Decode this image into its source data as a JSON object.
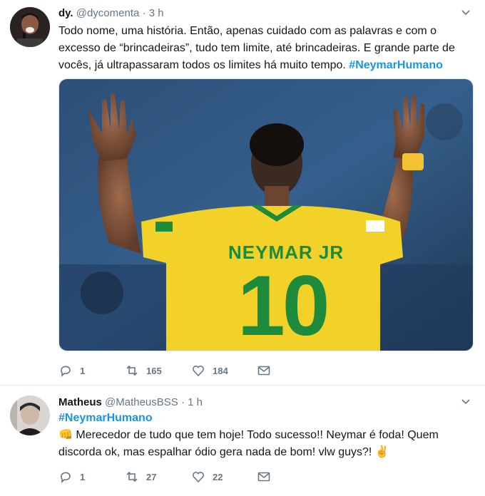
{
  "tweets": [
    {
      "name": "dy.",
      "handle": "@dycomenta",
      "dot": "·",
      "time": "3 h",
      "text_line1": "Todo nome, uma história. Então, apenas cuidado com as palavras e com o",
      "text_line2": "excesso de “brincadeiras”, tudo tem limite, até brincadeiras. E grande parte de",
      "text_line3": "vocês, já ultrapassaram todos os limites há muito tempo.",
      "hashtag": "#NeymarHumano",
      "photo": {
        "jersey_name": "NEYMAR JR",
        "jersey_number": "10"
      },
      "replies": "1",
      "retweets": "165",
      "likes": "184"
    },
    {
      "name": "Matheus",
      "handle": "@MatheusBSS",
      "dot": "·",
      "time": "1 h",
      "hashtag": "#NeymarHumano",
      "emoji_start": "👊",
      "text_line1": "Merecedor de tudo que tem hoje! Todo sucesso!! Neymar é foda! Quem",
      "text_line2": "discorda ok, mas espalhar ódio gera nada de bom! vlw guys?!",
      "emoji_end": "✌",
      "replies": "1",
      "retweets": "27",
      "likes": "22"
    }
  ],
  "colors": {
    "accent": "#1b95e0",
    "muted": "#657786",
    "jersey_yellow": "#f2d229",
    "jersey_green": "#1e8a3c"
  },
  "icons": [
    "reply-icon",
    "retweet-icon",
    "like-icon",
    "message-icon",
    "chevron-down-icon"
  ]
}
